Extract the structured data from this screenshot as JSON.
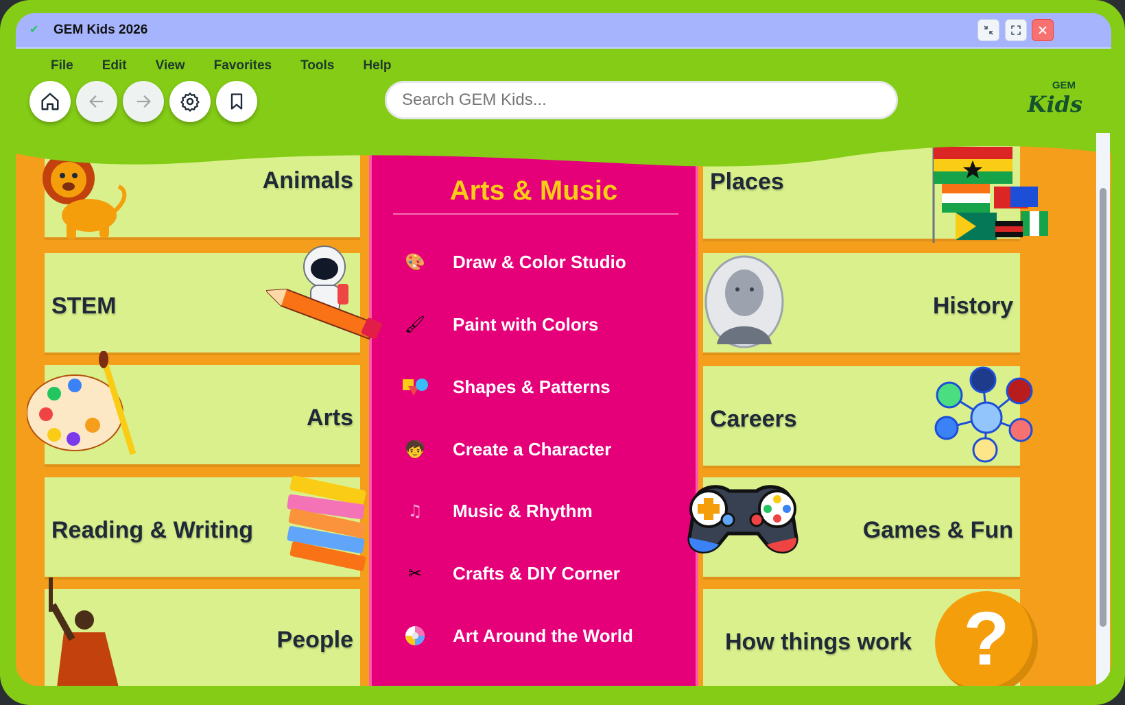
{
  "window": {
    "title": "GEM Kids 2026",
    "controls": [
      "minimize-icon",
      "maximize-icon",
      "close-icon"
    ]
  },
  "menu": [
    "File",
    "Edit",
    "View",
    "Favorites",
    "Tools",
    "Help"
  ],
  "toolbar": {
    "buttons": [
      "home-icon",
      "back-icon",
      "forward-icon",
      "settings-icon",
      "bookmark-icon"
    ]
  },
  "search": {
    "placeholder": "Search GEM Kids...",
    "value": ""
  },
  "brand": {
    "small": "GEM",
    "large": "Kids"
  },
  "categories_left": [
    "Animals",
    "STEM",
    "Arts",
    "Reading & Writing",
    "People"
  ],
  "categories_right": [
    "Places",
    "History",
    "Careers",
    "Games & Fun",
    "How things work"
  ],
  "panel": {
    "title": "Arts & Music",
    "items": [
      {
        "label": "Draw & Color Studio",
        "icon": "drawing-icon"
      },
      {
        "label": "Paint with Colors",
        "icon": "palette-icon"
      },
      {
        "label": "Shapes & Patterns",
        "icon": "shapes-icon"
      },
      {
        "label": "Create a Character",
        "icon": "character-icon"
      },
      {
        "label": "Music & Rhythm",
        "icon": "music-icon"
      },
      {
        "label": "Crafts & DIY Corner",
        "icon": "crafts-icon"
      },
      {
        "label": "Art Around the World",
        "icon": "globe-art-icon"
      }
    ]
  },
  "help_button": {
    "label": "?"
  },
  "colors": {
    "frame": "#84cc16",
    "titlebar": "#a5b4fc",
    "card": "#d9f08c",
    "stripe": "#f59e1b",
    "panel": "#e5007a",
    "panel_title": "#facc15"
  }
}
